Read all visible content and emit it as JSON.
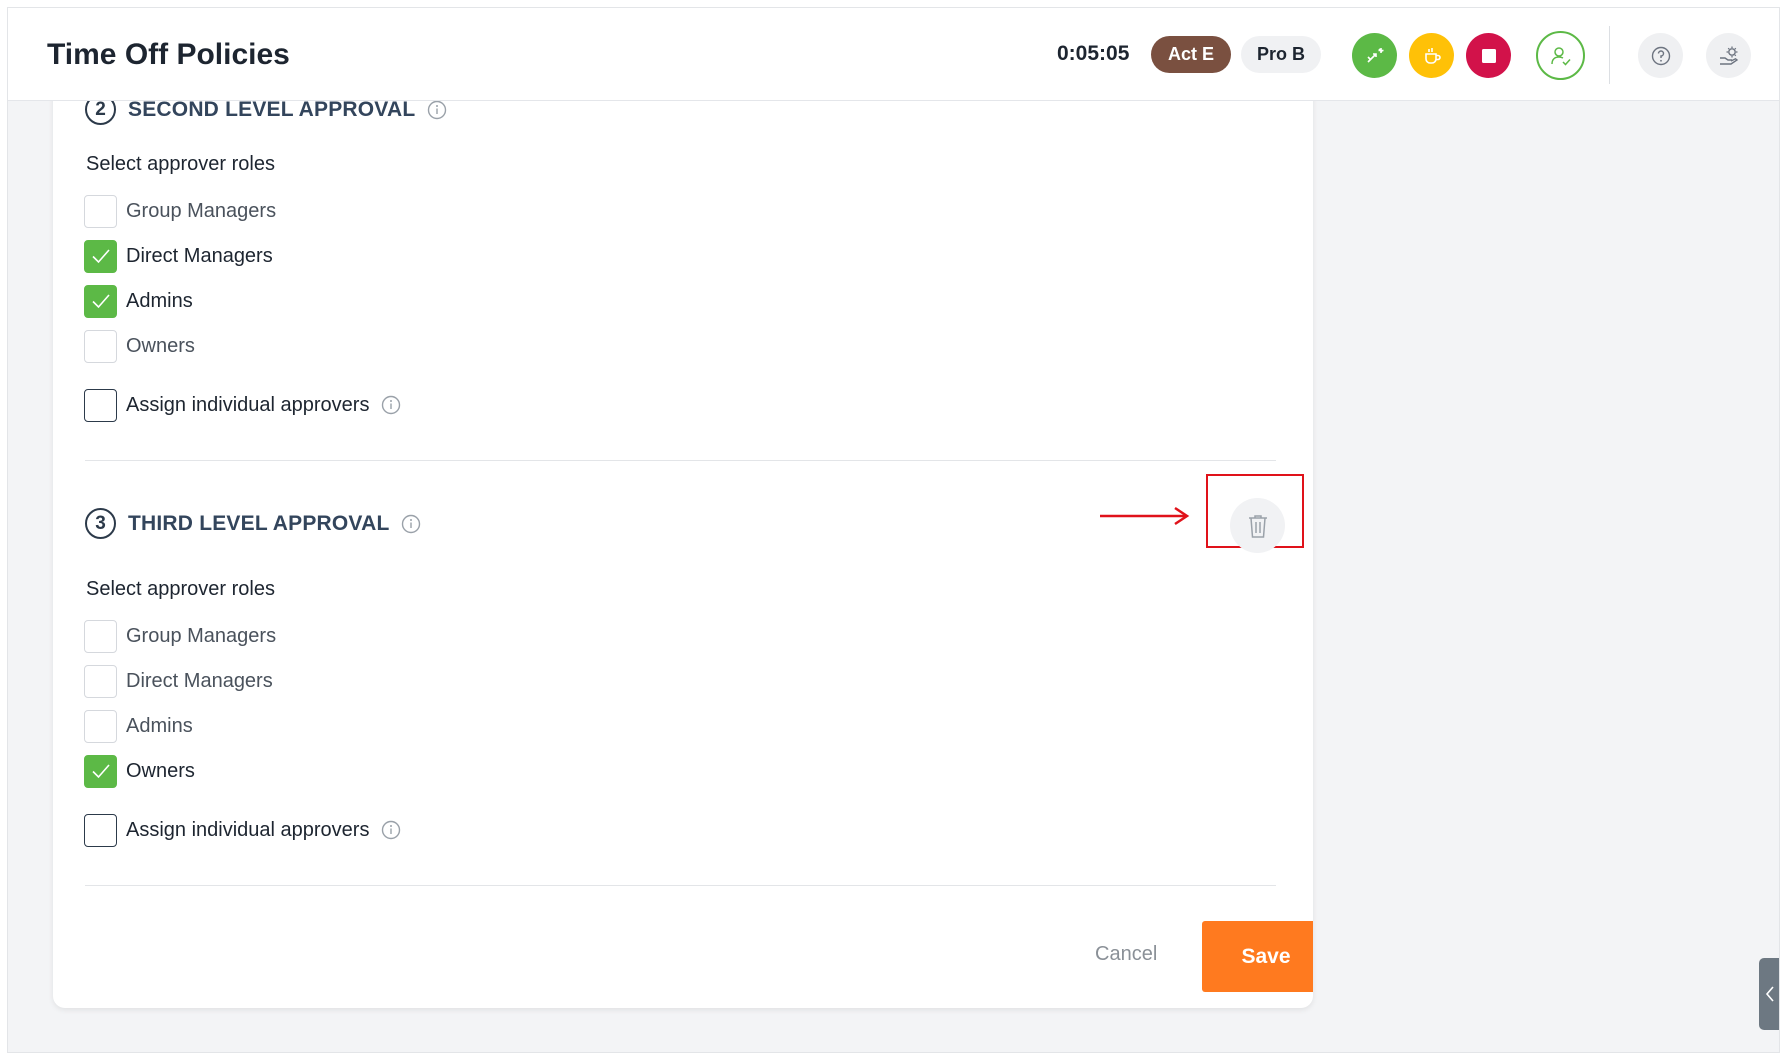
{
  "header": {
    "title": "Time Off Policies",
    "timer": "0:05:05",
    "activity_pill": "Act E",
    "project_pill": "Pro B"
  },
  "colors": {
    "green": "#5cb946",
    "yellow": "#ffc107",
    "red": "#d2124a",
    "orange": "#ff7a1f",
    "brown": "#7a5040",
    "highlight": "#e0121a"
  },
  "icons": [
    "switch-task-icon",
    "break-cup-icon",
    "stop-icon",
    "user-check-icon",
    "help-icon",
    "settings-icon",
    "info-icon",
    "trash-icon",
    "chevron-left-icon",
    "check-icon"
  ],
  "second_level": {
    "step": "2",
    "title": "SECOND LEVEL APPROVAL",
    "roles_label": "Select approver roles",
    "roles": [
      {
        "label": "Group Managers",
        "checked": false
      },
      {
        "label": "Direct Managers",
        "checked": true
      },
      {
        "label": "Admins",
        "checked": true
      },
      {
        "label": "Owners",
        "checked": false
      }
    ],
    "assign_label": "Assign individual approvers"
  },
  "third_level": {
    "step": "3",
    "title": "THIRD LEVEL APPROVAL",
    "roles_label": "Select approver roles",
    "roles": [
      {
        "label": "Group Managers",
        "checked": false
      },
      {
        "label": "Direct Managers",
        "checked": false
      },
      {
        "label": "Admins",
        "checked": false
      },
      {
        "label": "Owners",
        "checked": true
      }
    ],
    "assign_label": "Assign individual approvers"
  },
  "footer": {
    "cancel_label": "Cancel",
    "save_label": "Save"
  }
}
